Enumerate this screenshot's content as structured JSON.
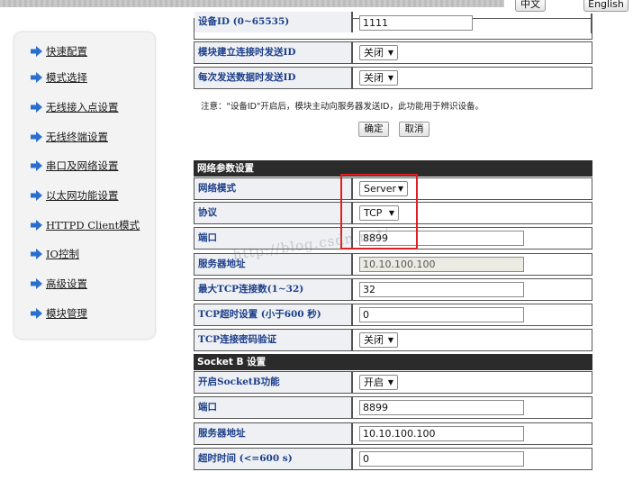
{
  "header": {
    "lang_cn": "中文",
    "lang_en": "English"
  },
  "sidebar": {
    "items": [
      {
        "label": "快速配置"
      },
      {
        "label": "模式选择"
      },
      {
        "label": "无线接入点设置"
      },
      {
        "label": "无线终端设置"
      },
      {
        "label": "串口及网络设置"
      },
      {
        "label": "以太网功能设置"
      },
      {
        "label": "HTTPD Client模式"
      },
      {
        "label": "IO控制"
      },
      {
        "label": "高级设置"
      },
      {
        "label": "模块管理"
      }
    ]
  },
  "top_form": {
    "device_id_label": "设备ID (0~65535)",
    "device_id_value": "1111",
    "send_on_connect_label": "模块建立连接时发送ID",
    "send_on_connect_value": "关闭",
    "send_each_label": "每次发送数据时发送ID",
    "send_each_value": "关闭",
    "note": "注意：\"设备ID\"开启后，模块主动向服务器发送ID，此功能用于辨识设备。",
    "ok_label": "确定",
    "cancel_label": "取消"
  },
  "network": {
    "section_title": "网络参数设置",
    "mode_label": "网络模式",
    "mode_value": "Server",
    "protocol_label": "协议",
    "protocol_value": "TCP",
    "port_label": "端口",
    "port_value": "8899",
    "server_label": "服务器地址",
    "server_value": "10.10.100.100",
    "max_tcp_label": "最大TCP连接数(1~32)",
    "max_tcp_value": "32",
    "tcp_timeout_label": "TCP超时设置 (小于600 秒)",
    "tcp_timeout_value": "0",
    "tcp_pwd_label": "TCP连接密码验证",
    "tcp_pwd_value": "关闭"
  },
  "socketb": {
    "section_title": "Socket B 设置",
    "enable_label": "开启SocketB功能",
    "enable_value": "开启",
    "port_label": "端口",
    "port_value": "8899",
    "server_label": "服务器地址",
    "server_value": "10.10.100.100",
    "timeout_label": "超时时间 (<=600 s)",
    "timeout_value": "0"
  },
  "watermark": "http://blog.csdn.net/",
  "colors": {
    "label_text": "#1c3e8a",
    "section_bg": "#2b2b2b",
    "highlight": "#e02020",
    "nav_arrow": "#2a6fd0"
  }
}
